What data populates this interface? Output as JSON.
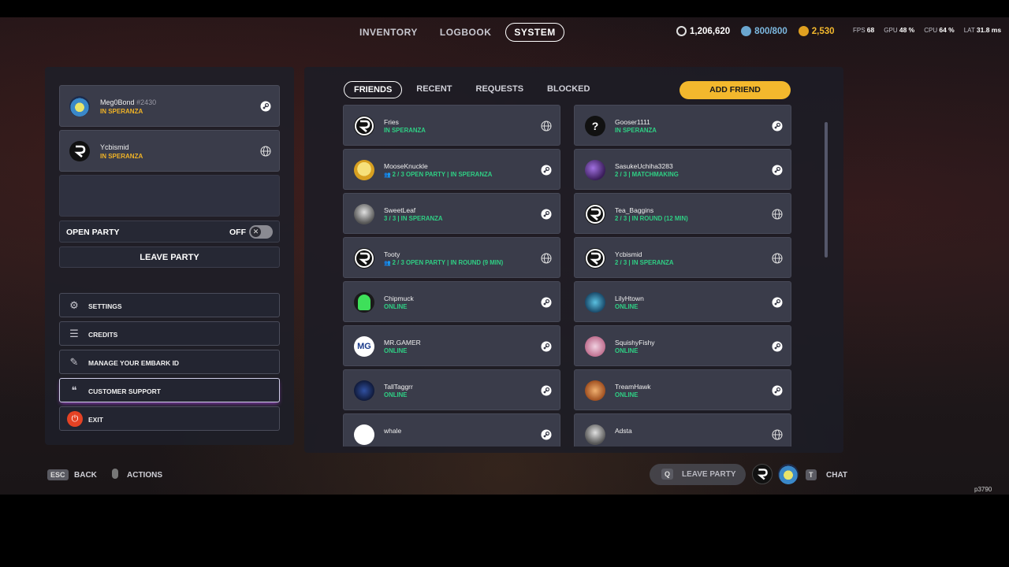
{
  "topnav": {
    "tabs": [
      {
        "label": "INVENTORY",
        "active": false
      },
      {
        "label": "LOGBOOK",
        "active": false
      },
      {
        "label": "SYSTEM",
        "active": true
      }
    ]
  },
  "currency": {
    "credits": "1,206,620",
    "capacity": "800/800",
    "gold": "2,530"
  },
  "perf": {
    "fps_label": "FPS",
    "fps": "68",
    "gpu_label": "GPU",
    "gpu": "48 %",
    "cpu_label": "CPU",
    "cpu": "64 %",
    "lat_label": "LAT",
    "lat": "31.8 ms"
  },
  "party": {
    "members": [
      {
        "name": "Meg0Bond",
        "tag": "#2430",
        "status": "IN SPERANZA",
        "platform": "steam-icon",
        "avatar": "bomb-avatar"
      },
      {
        "name": "Ycbismid",
        "tag": "",
        "status": "IN SPERANZA",
        "platform": "globe-icon",
        "avatar": "embark-avatar"
      }
    ],
    "open_party_label": "OPEN PARTY",
    "open_party_state": "OFF",
    "leave_label": "LEAVE PARTY"
  },
  "menu": {
    "items": [
      {
        "label": "SETTINGS",
        "icon": "gear-icon"
      },
      {
        "label": "CREDITS",
        "icon": "list-icon"
      },
      {
        "label": "MANAGE YOUR EMBARK ID",
        "icon": "pen-icon"
      },
      {
        "label": "CUSTOMER SUPPORT",
        "icon": "chat-bubbles-icon"
      },
      {
        "label": "EXIT",
        "icon": "power-icon"
      }
    ]
  },
  "friends": {
    "tabs": [
      {
        "label": "FRIENDS",
        "active": true
      },
      {
        "label": "RECENT",
        "active": false
      },
      {
        "label": "REQUESTS",
        "active": false
      },
      {
        "label": "BLOCKED",
        "active": false
      }
    ],
    "add_label": "ADD FRIEND",
    "list": [
      {
        "name": "Fries",
        "status": "IN SPERANZA",
        "platform": "globe",
        "avatar": "embark",
        "party": false
      },
      {
        "name": "Gooser1111",
        "status": "IN SPERANZA",
        "platform": "steam",
        "avatar": "question",
        "party": false
      },
      {
        "name": "MooseKnuckle",
        "status": "2 / 3 OPEN PARTY | IN SPERANZA",
        "platform": "steam",
        "avatar": "yellow",
        "party": true
      },
      {
        "name": "SasukeUchiha3283",
        "status": "2 / 3 | MATCHMAKING",
        "platform": "steam",
        "avatar": "purple",
        "party": false
      },
      {
        "name": "SweetLeaf",
        "status": "3 / 3 | IN SPERANZA",
        "platform": "steam",
        "avatar": "grey",
        "party": false
      },
      {
        "name": "Tea_Baggins",
        "status": "2 / 3 | IN ROUND (12 MIN)",
        "platform": "globe",
        "avatar": "embark",
        "party": false
      },
      {
        "name": "Tooty",
        "status": "2 / 3 OPEN PARTY | IN ROUND (9 MIN)",
        "platform": "globe",
        "avatar": "embark",
        "party": true
      },
      {
        "name": "Ycbismid",
        "status": "2 / 3 | IN SPERANZA",
        "platform": "globe",
        "avatar": "embark",
        "party": false
      },
      {
        "name": "Chipmuck",
        "status": "ONLINE",
        "platform": "steam",
        "avatar": "green",
        "party": false
      },
      {
        "name": "LilyHtown",
        "status": "ONLINE",
        "platform": "steam",
        "avatar": "teal",
        "party": false
      },
      {
        "name": "MR.GAMER",
        "status": "ONLINE",
        "platform": "steam",
        "avatar": "mg",
        "party": false
      },
      {
        "name": "SquishyFishy",
        "status": "ONLINE",
        "platform": "steam",
        "avatar": "pink",
        "party": false
      },
      {
        "name": "TallTaggrr",
        "status": "ONLINE",
        "platform": "steam",
        "avatar": "navy",
        "party": false
      },
      {
        "name": "TreamHawk",
        "status": "ONLINE",
        "platform": "steam",
        "avatar": "orange",
        "party": false
      },
      {
        "name": "whale",
        "status": "",
        "platform": "steam",
        "avatar": "white",
        "party": false
      },
      {
        "name": "Adsta",
        "status": "",
        "platform": "globe",
        "avatar": "grey",
        "party": false
      }
    ]
  },
  "bottom": {
    "esc_key": "ESC",
    "back_label": "BACK",
    "actions_label": "ACTIONS",
    "leave_key": "Q",
    "leave_label": "LEAVE PARTY",
    "chat_key": "T",
    "chat_label": "CHAT",
    "build_id": "p3790"
  },
  "colors": {
    "accent_yellow": "#f3b82d",
    "status_green": "#2fcf84",
    "status_gold": "#f0b326",
    "exit_red": "#e54224"
  }
}
